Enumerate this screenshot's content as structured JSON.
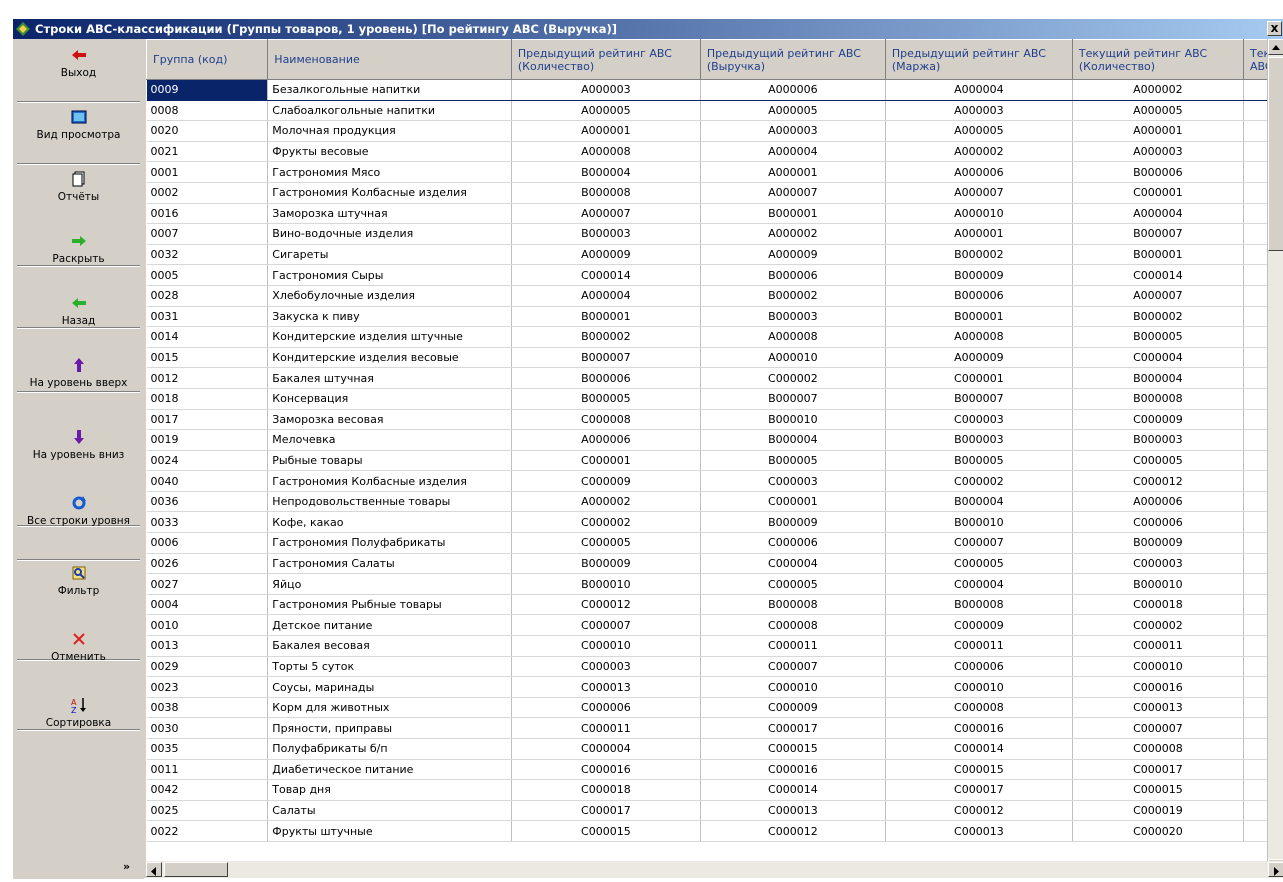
{
  "window": {
    "title": "Строки ABC-классификации (Группы товаров, 1 уровень) [По рейтингу ABC (Выручка)]",
    "close_label": "x"
  },
  "sidebar": {
    "buttons": [
      {
        "label": "Выход",
        "icon": "exit-arrow-icon"
      },
      {
        "label": "Вид просмотра",
        "icon": "view-mode-icon"
      },
      {
        "label": "Отчёты",
        "icon": "reports-icon"
      },
      {
        "label": "Раскрыть",
        "icon": "expand-arrow-icon"
      },
      {
        "label": "Назад",
        "icon": "back-arrow-icon"
      },
      {
        "label": "На уровень вверх",
        "icon": "level-up-icon"
      },
      {
        "label": "На уровень вниз",
        "icon": "level-down-icon"
      },
      {
        "label": "Все строки уровня",
        "icon": "refresh-icon"
      },
      {
        "label": "Фильтр",
        "icon": "filter-icon"
      },
      {
        "label": "Отменить",
        "icon": "cancel-icon"
      },
      {
        "label": "Сортировка",
        "icon": "sort-icon"
      }
    ],
    "more": "»"
  },
  "colors": {
    "title_start": "#0a246a",
    "title_end": "#a6caf0",
    "selection": "#0a246a",
    "header_text": "#1f3e8c"
  },
  "table": {
    "headers": [
      "Группа (код)",
      "Наименование",
      "Предыдущий рейтинг ABC (Количество)",
      "Предыдущий рейтинг ABC (Выручка)",
      "Предыдущий рейтинг ABC (Маржа)",
      "Текущий рейтинг ABC (Количество)",
      "Тек ABC"
    ],
    "selected_row": 0,
    "rows": [
      [
        "0009",
        "Безалкогольные напитки",
        "A000003",
        "A000006",
        "A000004",
        "A000002"
      ],
      [
        "0008",
        "Слабоалкогольные напитки",
        "A000005",
        "A000005",
        "A000003",
        "A000005"
      ],
      [
        "0020",
        "Молочная продукция",
        "A000001",
        "A000003",
        "A000005",
        "A000001"
      ],
      [
        "0021",
        "Фрукты весовые",
        "A000008",
        "A000004",
        "A000002",
        "A000003"
      ],
      [
        "0001",
        "Гастрономия Мясо",
        "B000004",
        "A000001",
        "A000006",
        "B000006"
      ],
      [
        "0002",
        "Гастрономия Колбасные изделия",
        "B000008",
        "A000007",
        "A000007",
        "C000001"
      ],
      [
        "0016",
        "Заморозка штучная",
        "A000007",
        "B000001",
        "A000010",
        "A000004"
      ],
      [
        "0007",
        "Вино-водочные изделия",
        "B000003",
        "A000002",
        "A000001",
        "B000007"
      ],
      [
        "0032",
        "Сигареты",
        "A000009",
        "A000009",
        "B000002",
        "B000001"
      ],
      [
        "0005",
        "Гастрономия Сыры",
        "C000014",
        "B000006",
        "B000009",
        "C000014"
      ],
      [
        "0028",
        "Хлебобулочные изделия",
        "A000004",
        "B000002",
        "B000006",
        "A000007"
      ],
      [
        "0031",
        "Закуска к пиву",
        "B000001",
        "B000003",
        "B000001",
        "B000002"
      ],
      [
        "0014",
        "Кондитерские изделия штучные",
        "B000002",
        "A000008",
        "A000008",
        "B000005"
      ],
      [
        "0015",
        "Кондитерские изделия весовые",
        "B000007",
        "A000010",
        "A000009",
        "C000004"
      ],
      [
        "0012",
        "Бакалея штучная",
        "B000006",
        "C000002",
        "C000001",
        "B000004"
      ],
      [
        "0018",
        "Консервация",
        "B000005",
        "B000007",
        "B000007",
        "B000008"
      ],
      [
        "0017",
        "Заморозка весовая",
        "C000008",
        "B000010",
        "C000003",
        "C000009"
      ],
      [
        "0019",
        "Мелочевка",
        "A000006",
        "B000004",
        "B000003",
        "B000003"
      ],
      [
        "0024",
        "Рыбные товары",
        "C000001",
        "B000005",
        "B000005",
        "C000005"
      ],
      [
        "0040",
        "Гастрономия Колбасные изделия",
        "C000009",
        "C000003",
        "C000002",
        "C000012"
      ],
      [
        "0036",
        "Непродовольственные товары",
        "A000002",
        "C000001",
        "B000004",
        "A000006"
      ],
      [
        "0033",
        "Кофе, какао",
        "C000002",
        "B000009",
        "B000010",
        "C000006"
      ],
      [
        "0006",
        "Гастрономия Полуфабрикаты",
        "C000005",
        "C000006",
        "C000007",
        "B000009"
      ],
      [
        "0026",
        "Гастрономия Салаты",
        "B000009",
        "C000004",
        "C000005",
        "C000003"
      ],
      [
        "0027",
        "Яйцо",
        "B000010",
        "C000005",
        "C000004",
        "B000010"
      ],
      [
        "0004",
        "Гастрономия Рыбные товары",
        "C000012",
        "B000008",
        "B000008",
        "C000018"
      ],
      [
        "0010",
        "Детское питание",
        "C000007",
        "C000008",
        "C000009",
        "C000002"
      ],
      [
        "0013",
        "Бакалея весовая",
        "C000010",
        "C000011",
        "C000011",
        "C000011"
      ],
      [
        "0029",
        "Торты 5 суток",
        "C000003",
        "C000007",
        "C000006",
        "C000010"
      ],
      [
        "0023",
        "Соусы, маринады",
        "C000013",
        "C000010",
        "C000010",
        "C000016"
      ],
      [
        "0038",
        "Корм для животных",
        "C000006",
        "C000009",
        "C000008",
        "C000013"
      ],
      [
        "0030",
        "Пряности, приправы",
        "C000011",
        "C000017",
        "C000016",
        "C000007"
      ],
      [
        "0035",
        "Полуфабрикаты б/п",
        "C000004",
        "C000015",
        "C000014",
        "C000008"
      ],
      [
        "0011",
        "Диабетическое питание",
        "C000016",
        "C000016",
        "C000015",
        "C000017"
      ],
      [
        "0042",
        "Товар дня",
        "C000018",
        "C000014",
        "C000017",
        "C000015"
      ],
      [
        "0025",
        "Салаты",
        "C000017",
        "C000013",
        "C000012",
        "C000019"
      ],
      [
        "0022",
        "Фрукты штучные",
        "C000015",
        "C000012",
        "C000013",
        "C000020"
      ]
    ]
  }
}
